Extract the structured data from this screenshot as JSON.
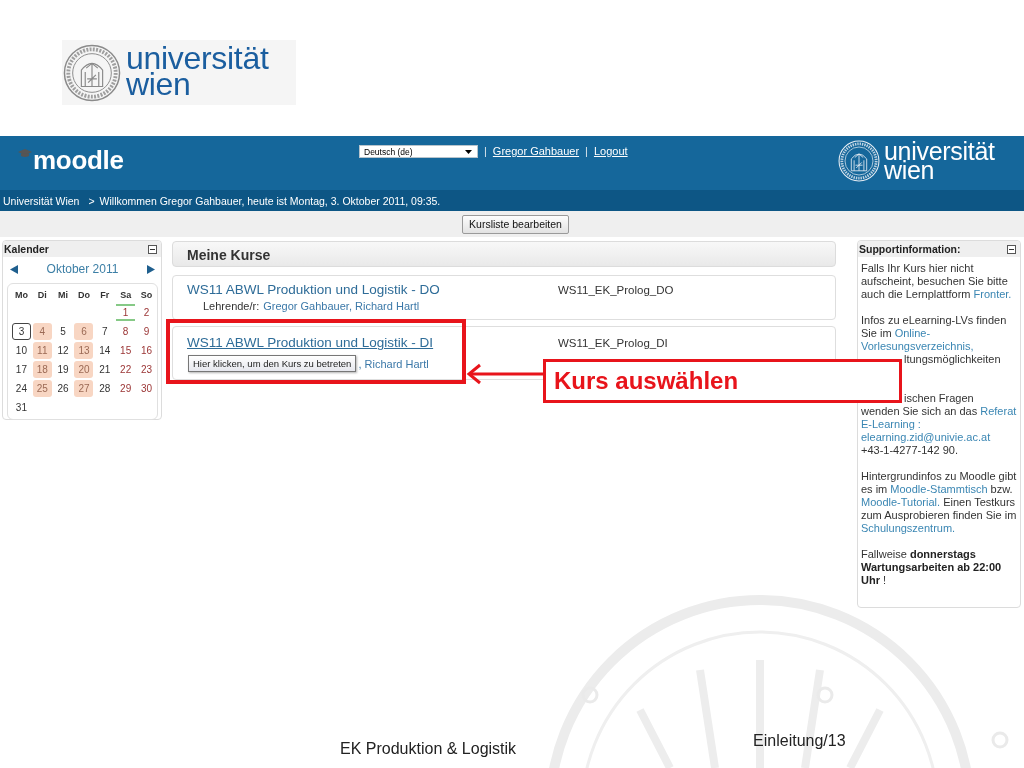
{
  "slide_logo": {
    "line1": "universität",
    "line2": "wien"
  },
  "header": {
    "logo": "moodle",
    "language": "Deutsch (de)",
    "links": [
      {
        "kind": "separator",
        "text": "|"
      },
      {
        "kind": "link",
        "text": "Gregor Gahbauer"
      },
      {
        "kind": "separator",
        "text": "|"
      },
      {
        "kind": "link",
        "text": "Logout"
      }
    ],
    "uni_logo": {
      "line1": "universität",
      "line2": "wien"
    }
  },
  "breadcrumb": {
    "home": "Universität Wien",
    "separator": ">",
    "current": "Willkommen Gregor Gahbauer, heute ist Montag, 3. Oktober 2011, 09:35."
  },
  "edit_button": "Kursliste bearbeiten",
  "calendar": {
    "title": "Kalender",
    "month": "Oktober 2011",
    "weekdays": [
      "Mo",
      "Di",
      "Mi",
      "Do",
      "Fr",
      "Sa",
      "So"
    ],
    "weeks": [
      [
        {
          "day": "1",
          "course_event": false,
          "global_event": true,
          "today": false
        },
        {
          "day": "2",
          "course_event": false,
          "global_event": false,
          "today": false
        }
      ],
      [
        {
          "day": "3",
          "course_event": false,
          "global_event": false,
          "today": true
        },
        {
          "day": "4",
          "course_event": true,
          "global_event": false,
          "today": false
        },
        {
          "day": "5",
          "course_event": false,
          "global_event": false,
          "today": false
        },
        {
          "day": "6",
          "course_event": true,
          "global_event": false,
          "today": false
        },
        {
          "day": "7",
          "course_event": false,
          "global_event": false,
          "today": false
        },
        {
          "day": "8",
          "course_event": false,
          "global_event": false,
          "today": false
        },
        {
          "day": "9",
          "course_event": false,
          "global_event": false,
          "today": false
        }
      ],
      [
        {
          "day": "10",
          "course_event": false,
          "global_event": false,
          "today": false
        },
        {
          "day": "11",
          "course_event": true,
          "global_event": false,
          "today": false
        },
        {
          "day": "12",
          "course_event": false,
          "global_event": false,
          "today": false
        },
        {
          "day": "13",
          "course_event": true,
          "global_event": false,
          "today": false
        },
        {
          "day": "14",
          "course_event": false,
          "global_event": false,
          "today": false
        },
        {
          "day": "15",
          "course_event": false,
          "global_event": false,
          "today": false
        },
        {
          "day": "16",
          "course_event": false,
          "global_event": false,
          "today": false
        }
      ],
      [
        {
          "day": "17",
          "course_event": false,
          "global_event": false,
          "today": false
        },
        {
          "day": "18",
          "course_event": true,
          "global_event": false,
          "today": false
        },
        {
          "day": "19",
          "course_event": false,
          "global_event": false,
          "today": false
        },
        {
          "day": "20",
          "course_event": true,
          "global_event": false,
          "today": false
        },
        {
          "day": "21",
          "course_event": false,
          "global_event": false,
          "today": false
        },
        {
          "day": "22",
          "course_event": false,
          "global_event": false,
          "today": false
        },
        {
          "day": "23",
          "course_event": false,
          "global_event": false,
          "today": false
        }
      ],
      [
        {
          "day": "24",
          "course_event": false,
          "global_event": false,
          "today": false
        },
        {
          "day": "25",
          "course_event": true,
          "global_event": false,
          "today": false
        },
        {
          "day": "26",
          "course_event": false,
          "global_event": false,
          "today": false
        },
        {
          "day": "27",
          "course_event": true,
          "global_event": false,
          "today": false
        },
        {
          "day": "28",
          "course_event": false,
          "global_event": false,
          "today": false
        },
        {
          "day": "29",
          "course_event": false,
          "global_event": false,
          "today": false
        },
        {
          "day": "30",
          "course_event": false,
          "global_event": false,
          "today": false
        }
      ],
      [
        {
          "day": "31",
          "course_event": false,
          "global_event": false,
          "today": false
        }
      ]
    ]
  },
  "courses": {
    "title": "Meine Kurse",
    "items": [
      {
        "name": "WS11 ABWL Produktion und Logistik - DO",
        "hovered": false,
        "short_name": "WS11_EK_Prolog_DO",
        "teachers_label": "Lehrende/r:",
        "teachers": "Gregor Gahbauer, Richard Hartl"
      },
      {
        "name": "WS11 ABWL Produktion und Logistik - DI",
        "hovered": true,
        "short_name": "WS11_EK_Prolog_DI",
        "tooltip": "Hier klicken, um den Kurs zu betreten",
        "teachers": ", Richard Hartl"
      }
    ]
  },
  "support": {
    "title": "Supportinformation:",
    "items": [
      {
        "kind": "paragraph",
        "segments": [
          {
            "kind": "text",
            "text": "Falls Ihr Kurs hier nicht aufscheint, besuchen Sie bitte auch die Lernplattform"
          },
          {
            "kind": "link",
            "text": "Fronter."
          }
        ]
      },
      {
        "kind": "paragraph",
        "segments": [
          {
            "kind": "text",
            "text": "Infos zu eLearning-LVs finden Sie im"
          },
          {
            "kind": "link",
            "text": "Online-"
          },
          {
            "kind": "link",
            "text": "Vorlesungsverzeichnis,"
          }
        ]
      },
      {
        "kind": "fragment",
        "text": "ltungsmöglichkeiten"
      },
      {
        "kind": "fragment",
        "text": "ischen Fragen"
      },
      {
        "kind": "paragraph",
        "segments": [
          {
            "kind": "text",
            "text": "wenden Sie sich an das"
          },
          {
            "kind": "link",
            "text": "Referat"
          },
          {
            "kind": "link",
            "text": "E-Learning :"
          },
          {
            "kind": "link",
            "text": "elearning.zid@univie.ac.at"
          },
          {
            "kind": "phone",
            "text": "+43-1-4277-142 90."
          }
        ]
      },
      {
        "kind": "paragraph",
        "segments": [
          {
            "kind": "text",
            "text": "Hintergrundinfos zu Moodle gibt es im"
          },
          {
            "kind": "link",
            "text": "Moodle-Stammtisch"
          },
          {
            "kind": "text",
            "text": "bzw."
          },
          {
            "kind": "link",
            "text": "Moodle-Tutorial."
          },
          {
            "kind": "text",
            "text": "Einen Testkurs zum Ausprobieren finden Sie im"
          },
          {
            "kind": "link",
            "text": "Schulungszentrum."
          }
        ]
      },
      {
        "kind": "paragraph",
        "segments": [
          {
            "kind": "text",
            "text": "Fallweise"
          },
          {
            "kind": "bold",
            "text": "donnerstags Wartungsarbeiten ab 22:00 Uhr"
          },
          {
            "kind": "text",
            "text": "!"
          }
        ]
      }
    ]
  },
  "annotation": {
    "label": "Kurs auswählen"
  },
  "footer": {
    "title": "EK Produktion & Logistik",
    "page": "Einleitung/13"
  }
}
